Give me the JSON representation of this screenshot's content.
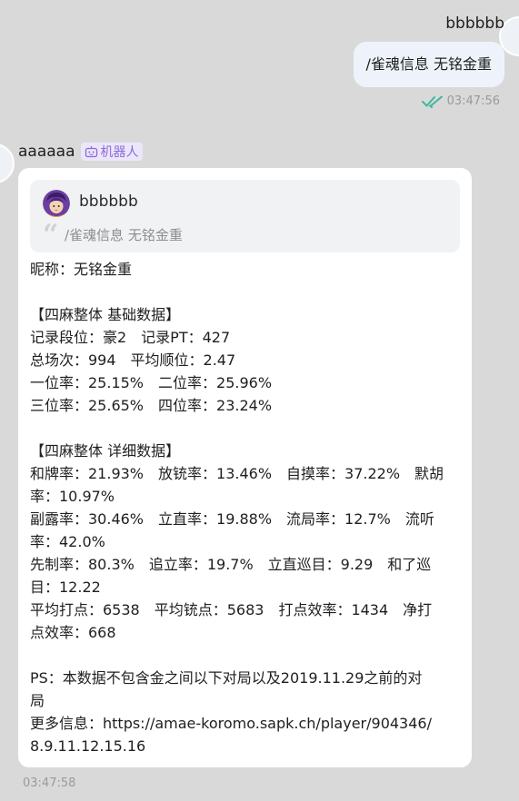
{
  "outgoing": {
    "sender": "bbbbbb",
    "text": "/雀魂信息 无铭金重",
    "time": "03:47:56",
    "status_icon": "double-check-icon",
    "status_color": "#3fb89a"
  },
  "incoming": {
    "sender": "aaaaaa",
    "bot_badge": "机器人",
    "bot_badge_color": "#8a6ad8",
    "time": "03:47:58",
    "quote": {
      "sender": "bbbbbb",
      "text": "/雀魂信息 无铭金重"
    },
    "lines": [
      "昵称：无铭金重",
      "",
      "【四麻整体 基础数据】",
      "记录段位：豪2　记录PT：427",
      "总场次：994　平均顺位：2.47",
      "一位率：25.15%　二位率：25.96%",
      "三位率：25.65%　四位率：23.24%",
      "",
      "【四麻整体 详细数据】",
      "和牌率：21.93%　放铳率：13.46%　自摸率：37.22%　默胡",
      "率：10.97%",
      "副露率：30.46%　立直率：19.88%　流局率：12.7%　流听",
      "率：42.0%",
      "先制率：80.3%　追立率：19.7%　立直巡目：9.29　和了巡",
      "目：12.22",
      "平均打点：6538　平均铳点：5683　打点效率：1434　净打",
      "点效率：668",
      "",
      "PS：本数据不包含金之间以下对局以及2019.11.29之前的对",
      "局",
      "更多信息：https://amae-koromo.sapk.ch/player/904346/",
      "8.9.11.12.15.16"
    ]
  }
}
